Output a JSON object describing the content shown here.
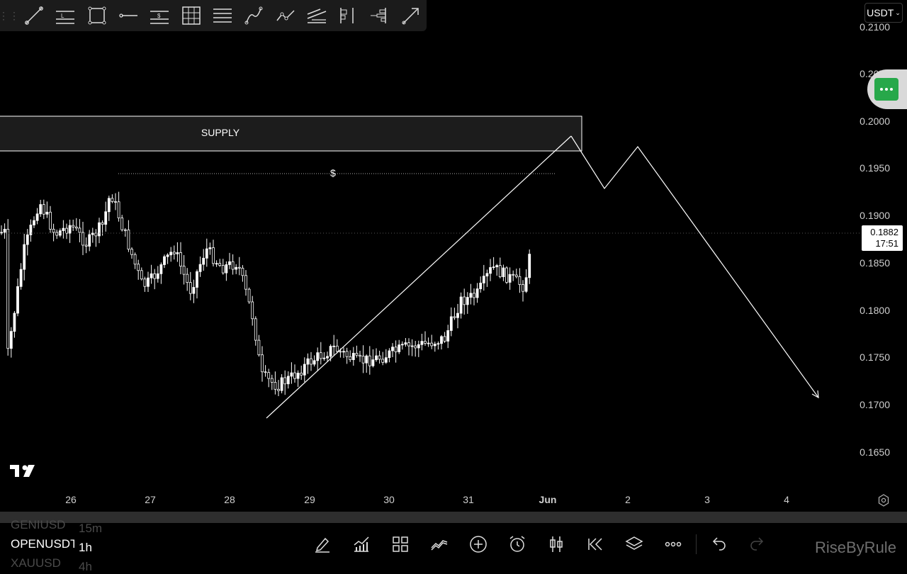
{
  "toolbar": {
    "tools": [
      {
        "name": "trend-line-tool-button",
        "icon": "trend-line-icon"
      },
      {
        "name": "price-label-tool-button",
        "icon": "price-level-icon",
        "text": "L"
      },
      {
        "name": "rectangle-tool-button",
        "icon": "rectangle-icon"
      },
      {
        "name": "horizontal-ray-tool-button",
        "icon": "horizontal-ray-icon"
      },
      {
        "name": "dollar-level-tool-button",
        "icon": "dollar-level-icon",
        "text": "$"
      },
      {
        "name": "grid-tool-button",
        "icon": "grid-icon"
      },
      {
        "name": "parallel-lines-tool-button",
        "icon": "parallel-lines-icon"
      },
      {
        "name": "curve-tool-button",
        "icon": "curve-icon"
      },
      {
        "name": "path-tool-button",
        "icon": "polyline-icon"
      },
      {
        "name": "regression-tool-button",
        "icon": "regression-icon"
      },
      {
        "name": "long-position-tool-button",
        "icon": "position-icon"
      },
      {
        "name": "volume-profile-tool-button",
        "icon": "volume-profile-icon"
      },
      {
        "name": "arrow-tool-button",
        "icon": "arrow-icon"
      }
    ]
  },
  "header": {
    "currency": "USDT"
  },
  "chart": {
    "price_labels": [
      "0.2100",
      "0.2050",
      "0.2000",
      "0.1950",
      "0.1900",
      "0.1850",
      "0.1800",
      "0.1750",
      "0.1700",
      "0.1650"
    ],
    "current_price": "0.1882",
    "countdown": "17:51",
    "time_labels": [
      "26",
      "27",
      "28",
      "29",
      "30",
      "31",
      "Jun",
      "2",
      "3",
      "4"
    ],
    "supply_label": "SUPPLY",
    "dollar_marker": "$",
    "colors": {
      "background": "#000000",
      "candles": "#ffffff",
      "drawings": "#ffffff",
      "accent": "#27a84a"
    }
  },
  "chart_data": {
    "type": "candlestick",
    "x_ticks": [
      "26",
      "27",
      "28",
      "29",
      "30",
      "31",
      "Jun",
      "2",
      "3",
      "4"
    ],
    "y_ticks": [
      0.165,
      0.17,
      0.175,
      0.18,
      0.185,
      0.19,
      0.195,
      0.2,
      0.205,
      0.21
    ],
    "ylim": [
      0.1625,
      0.2125
    ],
    "last_price": 0.1882,
    "close_path": [
      {
        "x": "25.2",
        "y": 0.175
      },
      {
        "x": "25.4",
        "y": 0.186
      },
      {
        "x": "25.6",
        "y": 0.1915
      },
      {
        "x": "25.8",
        "y": 0.188
      },
      {
        "x": "26.0",
        "y": 0.189
      },
      {
        "x": "26.2",
        "y": 0.187
      },
      {
        "x": "26.4",
        "y": 0.189
      },
      {
        "x": "26.5",
        "y": 0.1925
      },
      {
        "x": "26.7",
        "y": 0.1875
      },
      {
        "x": "26.9",
        "y": 0.1825
      },
      {
        "x": "27.0",
        "y": 0.183
      },
      {
        "x": "27.3",
        "y": 0.1865
      },
      {
        "x": "27.5",
        "y": 0.182
      },
      {
        "x": "27.7",
        "y": 0.1865
      },
      {
        "x": "27.9",
        "y": 0.1845
      },
      {
        "x": "28.1",
        "y": 0.185
      },
      {
        "x": "28.3",
        "y": 0.179
      },
      {
        "x": "28.4",
        "y": 0.173
      },
      {
        "x": "28.6",
        "y": 0.172
      },
      {
        "x": "28.8",
        "y": 0.173
      },
      {
        "x": "29.0",
        "y": 0.1745
      },
      {
        "x": "29.3",
        "y": 0.176
      },
      {
        "x": "29.6",
        "y": 0.1745
      },
      {
        "x": "29.9",
        "y": 0.175
      },
      {
        "x": "30.2",
        "y": 0.176
      },
      {
        "x": "30.5",
        "y": 0.1765
      },
      {
        "x": "30.7",
        "y": 0.177
      },
      {
        "x": "30.9",
        "y": 0.181
      },
      {
        "x": "31.1",
        "y": 0.1815
      },
      {
        "x": "31.3",
        "y": 0.1845
      },
      {
        "x": "31.5",
        "y": 0.1835
      },
      {
        "x": "31.7",
        "y": 0.1825
      },
      {
        "x": "31.8",
        "y": 0.1868
      },
      {
        "x": "31.9",
        "y": 0.1882
      }
    ],
    "annotations": {
      "supply_zone": [
        0.1972,
        0.2009
      ],
      "dollar_level": 0.1946,
      "ascending_line": [
        {
          "x": "28.5",
          "y": 0.1726
        },
        {
          "x": "Jun 1.3",
          "y": 0.1984
        }
      ],
      "projection_path": [
        {
          "x": "Jun 1.3",
          "y": 0.1984
        },
        {
          "x": "Jun 1.7",
          "y": 0.1928
        },
        {
          "x": "Jun 2.1",
          "y": 0.1972
        },
        {
          "x": "Jun 4.4",
          "y": 0.171
        }
      ]
    }
  },
  "watchlist": [
    {
      "symbol": "GENIUSD",
      "timeframe": "15m"
    },
    {
      "symbol": "OPENUSDT",
      "timeframe": "1h"
    },
    {
      "symbol": "XAUUSD",
      "timeframe": "4h"
    }
  ],
  "bottom_toolbar": [
    {
      "name": "draw-button",
      "icon": "pencil-icon"
    },
    {
      "name": "indicators-button",
      "icon": "indicators-icon"
    },
    {
      "name": "layouts-button",
      "icon": "grid-layout-icon"
    },
    {
      "name": "compare-button",
      "icon": "compare-icon"
    },
    {
      "name": "add-button",
      "icon": "plus-circle-icon"
    },
    {
      "name": "alert-button",
      "icon": "alarm-clock-icon"
    },
    {
      "name": "chart-type-button",
      "icon": "candles-icon"
    },
    {
      "name": "replay-button",
      "icon": "rewind-icon"
    },
    {
      "name": "object-tree-button",
      "icon": "layers-icon"
    },
    {
      "name": "more-button",
      "icon": "more-icon"
    },
    {
      "name": "undo-button",
      "icon": "undo-icon"
    },
    {
      "name": "redo-button",
      "icon": "redo-icon"
    }
  ],
  "watermark": "RiseByRule"
}
